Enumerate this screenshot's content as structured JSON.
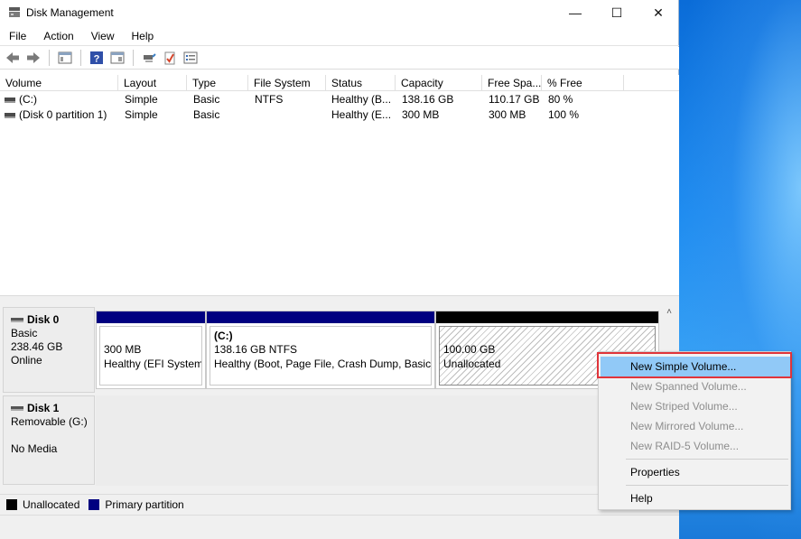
{
  "window": {
    "title": "Disk Management",
    "controls": {
      "minimize": "—",
      "maximize": "☐",
      "close": "✕"
    }
  },
  "menu": [
    "File",
    "Action",
    "View",
    "Help"
  ],
  "toolbar": {
    "buttons": [
      "back-icon",
      "forward-icon",
      "console-tree-icon",
      "help-icon",
      "show-pane-icon",
      "connect-icon",
      "check-icon",
      "properties-icon"
    ]
  },
  "volume_list": {
    "columns": [
      "Volume",
      "Layout",
      "Type",
      "File System",
      "Status",
      "Capacity",
      "Free Spa...",
      "% Free"
    ],
    "rows": [
      {
        "volume": "(C:)",
        "layout": "Simple",
        "type": "Basic",
        "fs": "NTFS",
        "status": "Healthy (B...",
        "capacity": "138.16 GB",
        "free": "110.17 GB",
        "pct_free": "80 %"
      },
      {
        "volume": "(Disk 0 partition 1)",
        "layout": "Simple",
        "type": "Basic",
        "fs": "",
        "status": "Healthy (E...",
        "capacity": "300 MB",
        "free": "300 MB",
        "pct_free": "100 %"
      }
    ]
  },
  "disks": {
    "disk0": {
      "name": "Disk 0",
      "type": "Basic",
      "size": "238.46 GB",
      "state": "Online",
      "partitions": [
        {
          "title": "",
          "size": "300 MB",
          "status": "Healthy (EFI System"
        },
        {
          "title": "(C:)",
          "size": "138.16 GB NTFS",
          "status": "Healthy (Boot, Page File, Crash Dump, Basic D"
        },
        {
          "title": "",
          "size": "100.00 GB",
          "status": "Unallocated"
        }
      ]
    },
    "disk1": {
      "name": "Disk 1",
      "type": "Removable (G:)",
      "state": "No Media"
    }
  },
  "legend": {
    "unallocated": "Unallocated",
    "primary": "Primary partition"
  },
  "context_menu": {
    "items": [
      {
        "label": "New Simple Volume...",
        "enabled": true
      },
      {
        "label": "New Spanned Volume...",
        "enabled": false
      },
      {
        "label": "New Striped Volume...",
        "enabled": false
      },
      {
        "label": "New Mirrored Volume...",
        "enabled": false
      },
      {
        "label": "New RAID-5 Volume...",
        "enabled": false
      },
      {
        "label": "Properties",
        "enabled": true
      },
      {
        "label": "Help",
        "enabled": true
      }
    ]
  },
  "colors": {
    "primary_partition": "#000080",
    "unallocated": "#000000",
    "highlight": "#91c9f7",
    "annotation_frame": "#e0343a"
  }
}
